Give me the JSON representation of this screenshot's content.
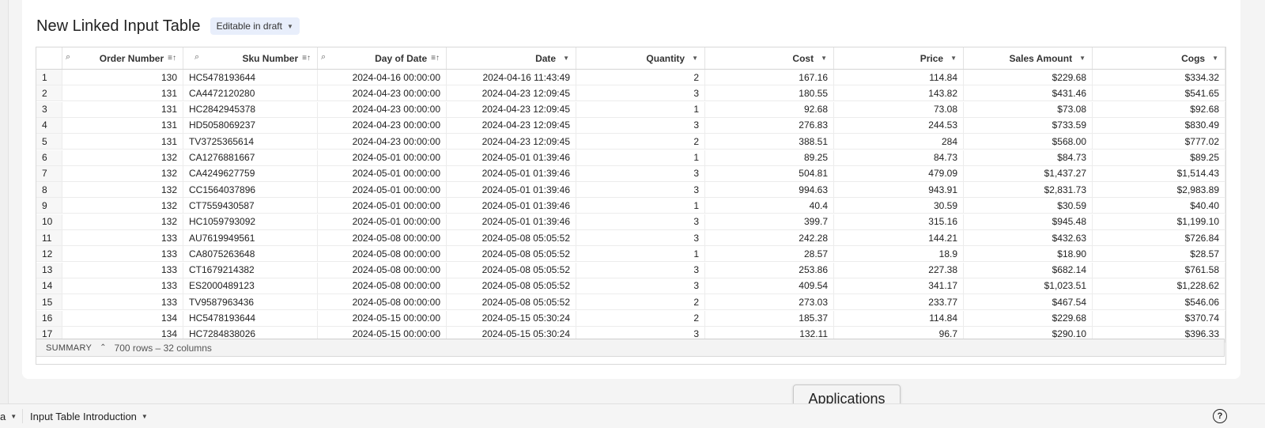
{
  "title": "New Linked Input Table",
  "badge": {
    "label": "Editable in draft"
  },
  "columns": [
    {
      "label": "",
      "key": false
    },
    {
      "label": "",
      "key": true
    },
    {
      "label": "Order Number",
      "sort": true
    },
    {
      "label": "Sku Number",
      "sort": true,
      "key": true
    },
    {
      "label": "",
      "key": true
    },
    {
      "label": "Day of Date",
      "sort": true
    },
    {
      "label": "Date",
      "chev": true
    },
    {
      "label": "Quantity",
      "chev": true
    },
    {
      "label": "Cost",
      "chev": true
    },
    {
      "label": "Price",
      "chev": true
    },
    {
      "label": "Sales Amount",
      "chev": true
    },
    {
      "label": "Cogs",
      "chev": true
    }
  ],
  "rows": [
    [
      "1",
      "130",
      "HC5478193644",
      "2024-04-16 00:00:00",
      "2024-04-16 11:43:49",
      "2",
      "167.16",
      "114.84",
      "$229.68",
      "$334.32"
    ],
    [
      "2",
      "131",
      "CA4472120280",
      "2024-04-23 00:00:00",
      "2024-04-23 12:09:45",
      "3",
      "180.55",
      "143.82",
      "$431.46",
      "$541.65"
    ],
    [
      "3",
      "131",
      "HC2842945378",
      "2024-04-23 00:00:00",
      "2024-04-23 12:09:45",
      "1",
      "92.68",
      "73.08",
      "$73.08",
      "$92.68"
    ],
    [
      "4",
      "131",
      "HD5058069237",
      "2024-04-23 00:00:00",
      "2024-04-23 12:09:45",
      "3",
      "276.83",
      "244.53",
      "$733.59",
      "$830.49"
    ],
    [
      "5",
      "131",
      "TV3725365614",
      "2024-04-23 00:00:00",
      "2024-04-23 12:09:45",
      "2",
      "388.51",
      "284",
      "$568.00",
      "$777.02"
    ],
    [
      "6",
      "132",
      "CA1276881667",
      "2024-05-01 00:00:00",
      "2024-05-01 01:39:46",
      "1",
      "89.25",
      "84.73",
      "$84.73",
      "$89.25"
    ],
    [
      "7",
      "132",
      "CA4249627759",
      "2024-05-01 00:00:00",
      "2024-05-01 01:39:46",
      "3",
      "504.81",
      "479.09",
      "$1,437.27",
      "$1,514.43"
    ],
    [
      "8",
      "132",
      "CC1564037896",
      "2024-05-01 00:00:00",
      "2024-05-01 01:39:46",
      "3",
      "994.63",
      "943.91",
      "$2,831.73",
      "$2,983.89"
    ],
    [
      "9",
      "132",
      "CT7559430587",
      "2024-05-01 00:00:00",
      "2024-05-01 01:39:46",
      "1",
      "40.4",
      "30.59",
      "$30.59",
      "$40.40"
    ],
    [
      "10",
      "132",
      "HC1059793092",
      "2024-05-01 00:00:00",
      "2024-05-01 01:39:46",
      "3",
      "399.7",
      "315.16",
      "$945.48",
      "$1,199.10"
    ],
    [
      "11",
      "133",
      "AU7619949561",
      "2024-05-08 00:00:00",
      "2024-05-08 05:05:52",
      "3",
      "242.28",
      "144.21",
      "$432.63",
      "$726.84"
    ],
    [
      "12",
      "133",
      "CA8075263648",
      "2024-05-08 00:00:00",
      "2024-05-08 05:05:52",
      "1",
      "28.57",
      "18.9",
      "$18.90",
      "$28.57"
    ],
    [
      "13",
      "133",
      "CT1679214382",
      "2024-05-08 00:00:00",
      "2024-05-08 05:05:52",
      "3",
      "253.86",
      "227.38",
      "$682.14",
      "$761.58"
    ],
    [
      "14",
      "133",
      "ES2000489123",
      "2024-05-08 00:00:00",
      "2024-05-08 05:05:52",
      "3",
      "409.54",
      "341.17",
      "$1,023.51",
      "$1,228.62"
    ],
    [
      "15",
      "133",
      "TV9587963436",
      "2024-05-08 00:00:00",
      "2024-05-08 05:05:52",
      "2",
      "273.03",
      "233.77",
      "$467.54",
      "$546.06"
    ],
    [
      "16",
      "134",
      "HC5478193644",
      "2024-05-15 00:00:00",
      "2024-05-15 05:30:24",
      "2",
      "185.37",
      "114.84",
      "$229.68",
      "$370.74"
    ],
    [
      "17",
      "134",
      "HC7284838026",
      "2024-05-15 00:00:00",
      "2024-05-15 05:30:24",
      "3",
      "132.11",
      "96.7",
      "$290.10",
      "$396.33"
    ]
  ],
  "summary": {
    "label": "SUMMARY",
    "info": "700 rows – 32 columns"
  },
  "bottom": {
    "fragment": "a",
    "tab": "Input Table Introduction"
  },
  "tooltip": "Applications",
  "help": "?"
}
